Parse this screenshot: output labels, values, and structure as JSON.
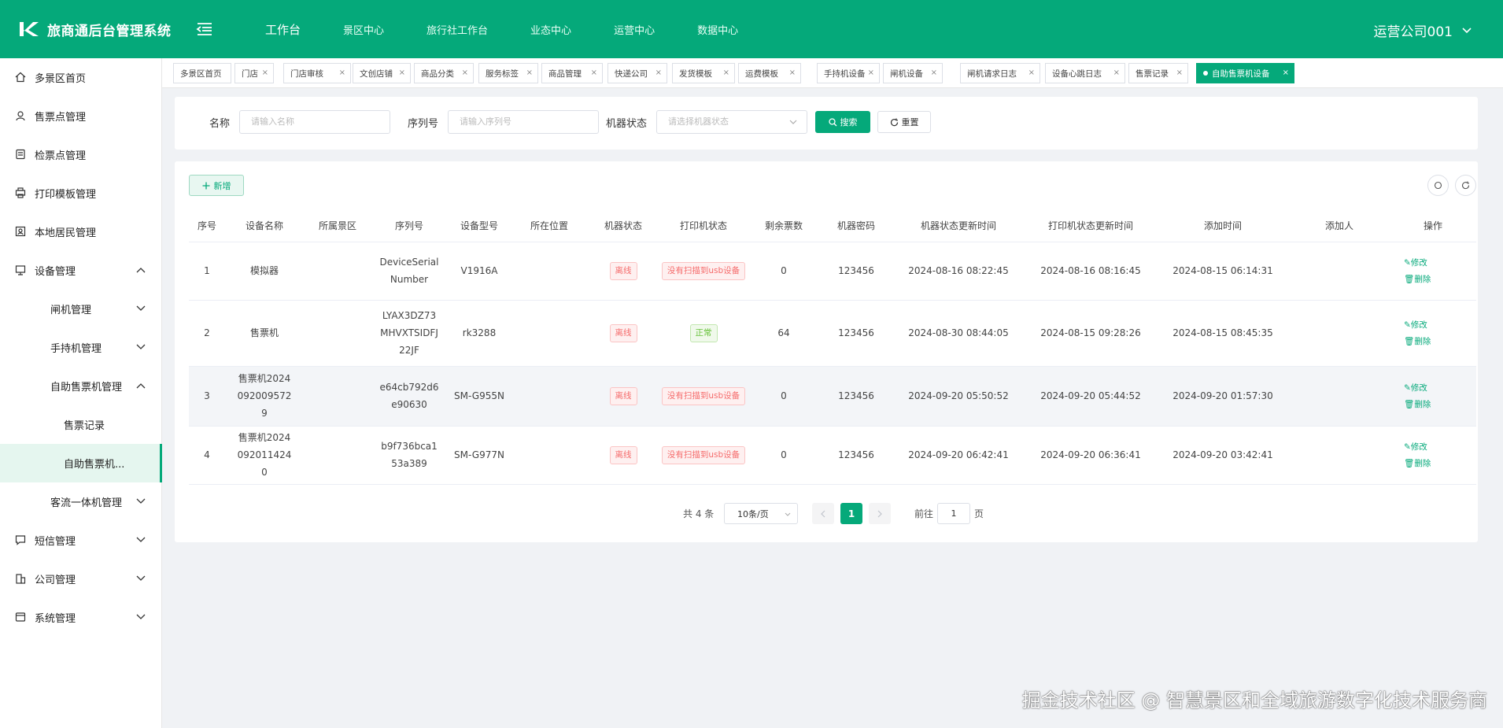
{
  "app": {
    "title": "旅商通后台管理系统",
    "user": "运营公司001"
  },
  "topnav": [
    "工作台",
    "景区中心",
    "旅行社工作台",
    "业态中心",
    "运营中心",
    "数据中心"
  ],
  "sidebar": {
    "items": [
      {
        "label": "多景区首页",
        "icon": "home-icon"
      },
      {
        "label": "售票点管理",
        "icon": "ticket-point-icon"
      },
      {
        "label": "检票点管理",
        "icon": "check-point-icon"
      },
      {
        "label": "打印模板管理",
        "icon": "print-template-icon"
      },
      {
        "label": "本地居民管理",
        "icon": "resident-icon"
      },
      {
        "label": "设备管理",
        "icon": "device-icon"
      },
      {
        "label": "闸机管理"
      },
      {
        "label": "手持机管理"
      },
      {
        "label": "自助售票机管理"
      },
      {
        "label": "售票记录"
      },
      {
        "label": "自助售票机..."
      },
      {
        "label": "客流一体机管理"
      },
      {
        "label": "短信管理",
        "icon": "sms-icon"
      },
      {
        "label": "公司管理",
        "icon": "company-icon"
      },
      {
        "label": "系统管理",
        "icon": "system-icon"
      }
    ]
  },
  "tabs": [
    "多景区首页",
    "门店",
    "门店审核",
    "文创店铺",
    "商品分类",
    "服务标签",
    "商品管理",
    "快递公司",
    "发货模板",
    "运费模板",
    "手持机设备",
    "闸机设备",
    "闸机请求日志",
    "设备心跳日志",
    "售票记录",
    "自助售票机设备"
  ],
  "search": {
    "name_label": "名称",
    "name_placeholder": "请输入名称",
    "serial_label": "序列号",
    "serial_placeholder": "请输入序列号",
    "status_label": "机器状态",
    "status_placeholder": "请选择机器状态",
    "search_btn": "搜索",
    "reset_btn": "重置"
  },
  "toolbar": {
    "add": "新增"
  },
  "table": {
    "headers": [
      "序号",
      "设备名称",
      "所属景区",
      "序列号",
      "设备型号",
      "所在位置",
      "机器状态",
      "打印机状态",
      "剩余票数",
      "机器密码",
      "机器状态更新时间",
      "打印机状态更新时间",
      "添加时间",
      "添加人",
      "操作"
    ],
    "rows": [
      {
        "no": "1",
        "name": "模拟器",
        "area": "",
        "serial": "DeviceSerialNumber",
        "model": "V1916A",
        "location": "",
        "status": "离线",
        "printer": "没有扫描到usb设备",
        "tickets": "0",
        "password": "123456",
        "status_time": "2024-08-16 08:22:45",
        "printer_time": "2024-08-16 08:16:45",
        "add_time": "2024-08-15 06:14:31",
        "adder": ""
      },
      {
        "no": "2",
        "name": "售票机",
        "area": "",
        "serial": "LYAX3DZ73MHVXTSIDFJ22JF",
        "model": "rk3288",
        "location": "",
        "status": "离线",
        "printer": "正常",
        "tickets": "64",
        "password": "123456",
        "status_time": "2024-08-30 08:44:05",
        "printer_time": "2024-08-15 09:28:26",
        "add_time": "2024-08-15 08:45:35",
        "adder": ""
      },
      {
        "no": "3",
        "name": "售票机20240920095729",
        "area": "",
        "serial": "e64cb792d6e90630",
        "model": "SM-G955N",
        "location": "",
        "status": "离线",
        "printer": "没有扫描到usb设备",
        "tickets": "0",
        "password": "123456",
        "status_time": "2024-09-20 05:50:52",
        "printer_time": "2024-09-20 05:44:52",
        "add_time": "2024-09-20 01:57:30",
        "adder": ""
      },
      {
        "no": "4",
        "name": "售票机20240920114240",
        "area": "",
        "serial": "b9f736bca153a389",
        "model": "SM-G977N",
        "location": "",
        "status": "离线",
        "printer": "没有扫描到usb设备",
        "tickets": "0",
        "password": "123456",
        "status_time": "2024-09-20 06:42:41",
        "printer_time": "2024-09-20 06:36:41",
        "add_time": "2024-09-20 03:42:41",
        "adder": ""
      }
    ],
    "edit": "修改",
    "delete": "删除"
  },
  "pager": {
    "total": "共 4 条",
    "size": "10条/页",
    "current": "1",
    "goto_label": "前往",
    "goto_value": "1",
    "page_unit": "页"
  },
  "watermark": "掘金技术社区 @ 智慧景区和全域旅游数字化技术服务商",
  "colors": {
    "primary": "#05a97a",
    "danger": "#f56c6c",
    "success": "#67c23a"
  }
}
